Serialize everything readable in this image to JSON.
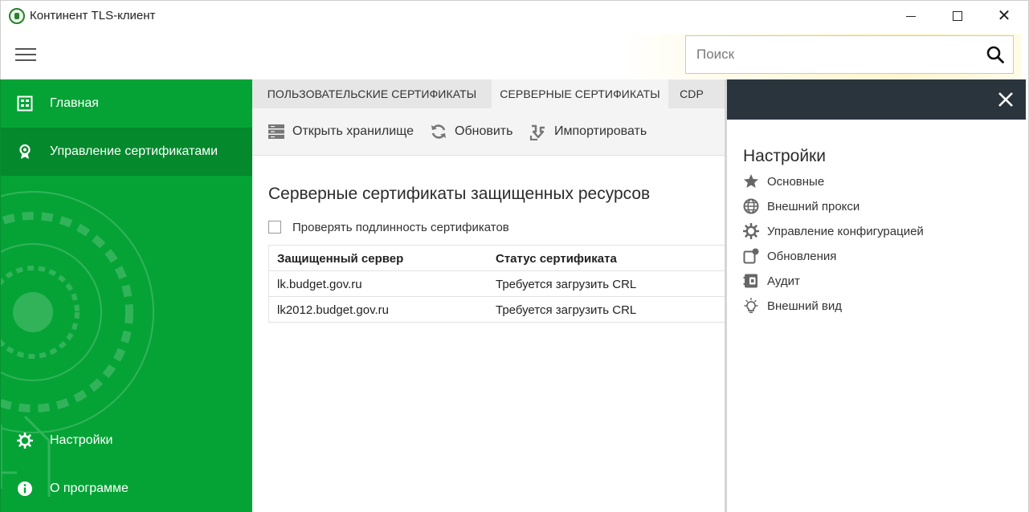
{
  "window": {
    "title": "Континент TLS-клиент",
    "controls": {
      "minimize": "minimize",
      "maximize": "maximize",
      "close": "✕"
    }
  },
  "search": {
    "placeholder": "Поиск",
    "value": ""
  },
  "sidebar": {
    "items": [
      {
        "label": "Главная",
        "icon": "home-grid-icon"
      },
      {
        "label": "Управление сертификатами",
        "icon": "certificate-badge-icon",
        "active": true
      },
      {
        "label": "Настройки",
        "icon": "gear-icon"
      },
      {
        "label": "О программе",
        "icon": "info-icon"
      }
    ]
  },
  "tabs": [
    {
      "label": "ПОЛЬЗОВАТЕЛЬСКИЕ СЕРТИФИКАТЫ"
    },
    {
      "label": "СЕРВЕРНЫЕ СЕРТИФИКАТЫ",
      "active": true
    },
    {
      "label": "CDP"
    }
  ],
  "toolbar": {
    "open_store": "Открыть хранилище",
    "refresh": "Обновить",
    "import": "Импортировать"
  },
  "content": {
    "title": "Серверные сертификаты защищенных ресурсов",
    "verify_label": "Проверять подлинность сертификатов",
    "verify_checked": false,
    "columns": [
      "Защищенный сервер",
      "Статус сертификата"
    ],
    "rows": [
      {
        "server": "lk.budget.gov.ru",
        "status": "Требуется загрузить CRL"
      },
      {
        "server": "lk2012.budget.gov.ru",
        "status": "Требуется загрузить CRL"
      }
    ]
  },
  "settings_panel": {
    "title": "Настройки",
    "items": [
      {
        "label": "Основные",
        "icon": "star-icon"
      },
      {
        "label": "Внешний прокси",
        "icon": "globe-icon"
      },
      {
        "label": "Управление конфигурацией",
        "icon": "gear-icon"
      },
      {
        "label": "Обновления",
        "icon": "update-badge-icon"
      },
      {
        "label": "Аудит",
        "icon": "audit-journal-icon"
      },
      {
        "label": "Внешний вид",
        "icon": "lightbulb-icon"
      }
    ]
  },
  "colors": {
    "sidebar_green": "#05a336",
    "sidebar_active": "#04892d",
    "panel_header": "#2a343d"
  }
}
